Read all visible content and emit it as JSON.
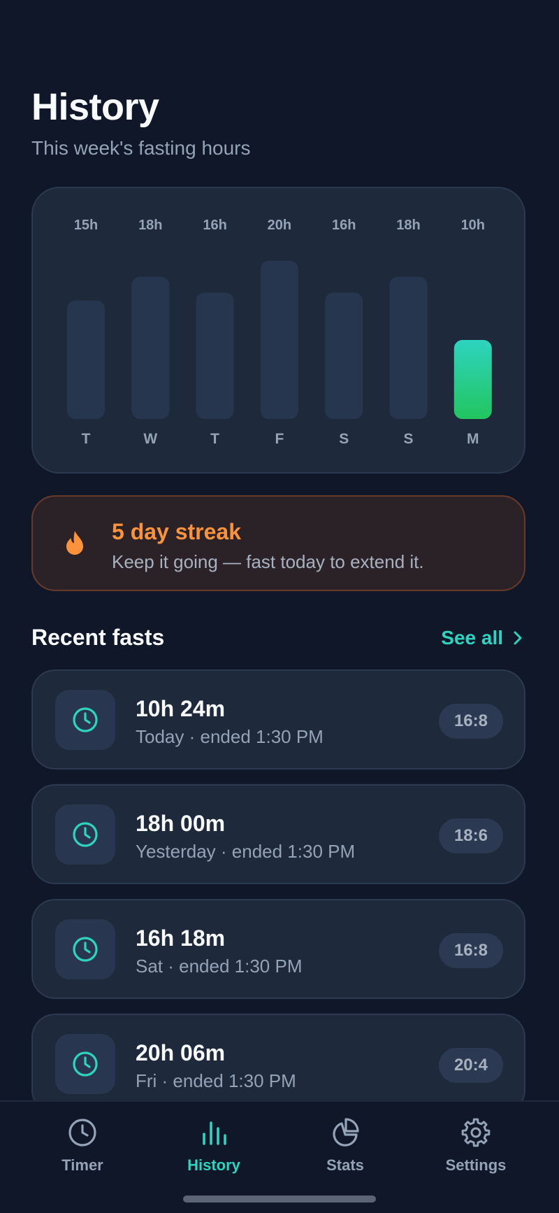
{
  "header": {
    "title": "History",
    "subtitle": "This week's fasting hours"
  },
  "chart_data": {
    "type": "bar",
    "categories": [
      "T",
      "W",
      "T",
      "F",
      "S",
      "S",
      "M"
    ],
    "values": [
      15,
      18,
      16,
      20,
      16,
      18,
      10
    ],
    "value_labels": [
      "15h",
      "18h",
      "16h",
      "20h",
      "16h",
      "18h",
      "10h"
    ],
    "highlight_index": 6,
    "ylim": [
      0,
      20
    ],
    "grid": false,
    "colors": {
      "bar": "#27364f",
      "highlight_top": "#2dd4bf",
      "highlight_bottom": "#22c55e",
      "label": "#94a3b8"
    }
  },
  "streak": {
    "icon": "flame-icon",
    "title": "5 day streak",
    "text": "Keep it going — fast today to extend it."
  },
  "recent": {
    "title": "Recent fasts",
    "see_all": "See all",
    "items": [
      {
        "duration": "10h 24m",
        "meta": "Today · ended 1:30 PM",
        "plan": "16:8"
      },
      {
        "duration": "18h 00m",
        "meta": "Yesterday · ended 1:30 PM",
        "plan": "18:6"
      },
      {
        "duration": "16h 18m",
        "meta": "Sat · ended 1:30 PM",
        "plan": "16:8"
      },
      {
        "duration": "20h 06m",
        "meta": "Fri · ended 1:30 PM",
        "plan": "20:4"
      }
    ]
  },
  "nav": {
    "active": "History",
    "items": [
      {
        "label": "Timer",
        "icon": "clock-icon"
      },
      {
        "label": "History",
        "icon": "bar-chart-icon"
      },
      {
        "label": "Stats",
        "icon": "pie-chart-icon"
      },
      {
        "label": "Settings",
        "icon": "gear-icon"
      }
    ]
  },
  "colors": {
    "background": "#0f1729",
    "card": "#1e293b",
    "accent": "#2dd4bf",
    "streak_accent": "#fb923c"
  }
}
